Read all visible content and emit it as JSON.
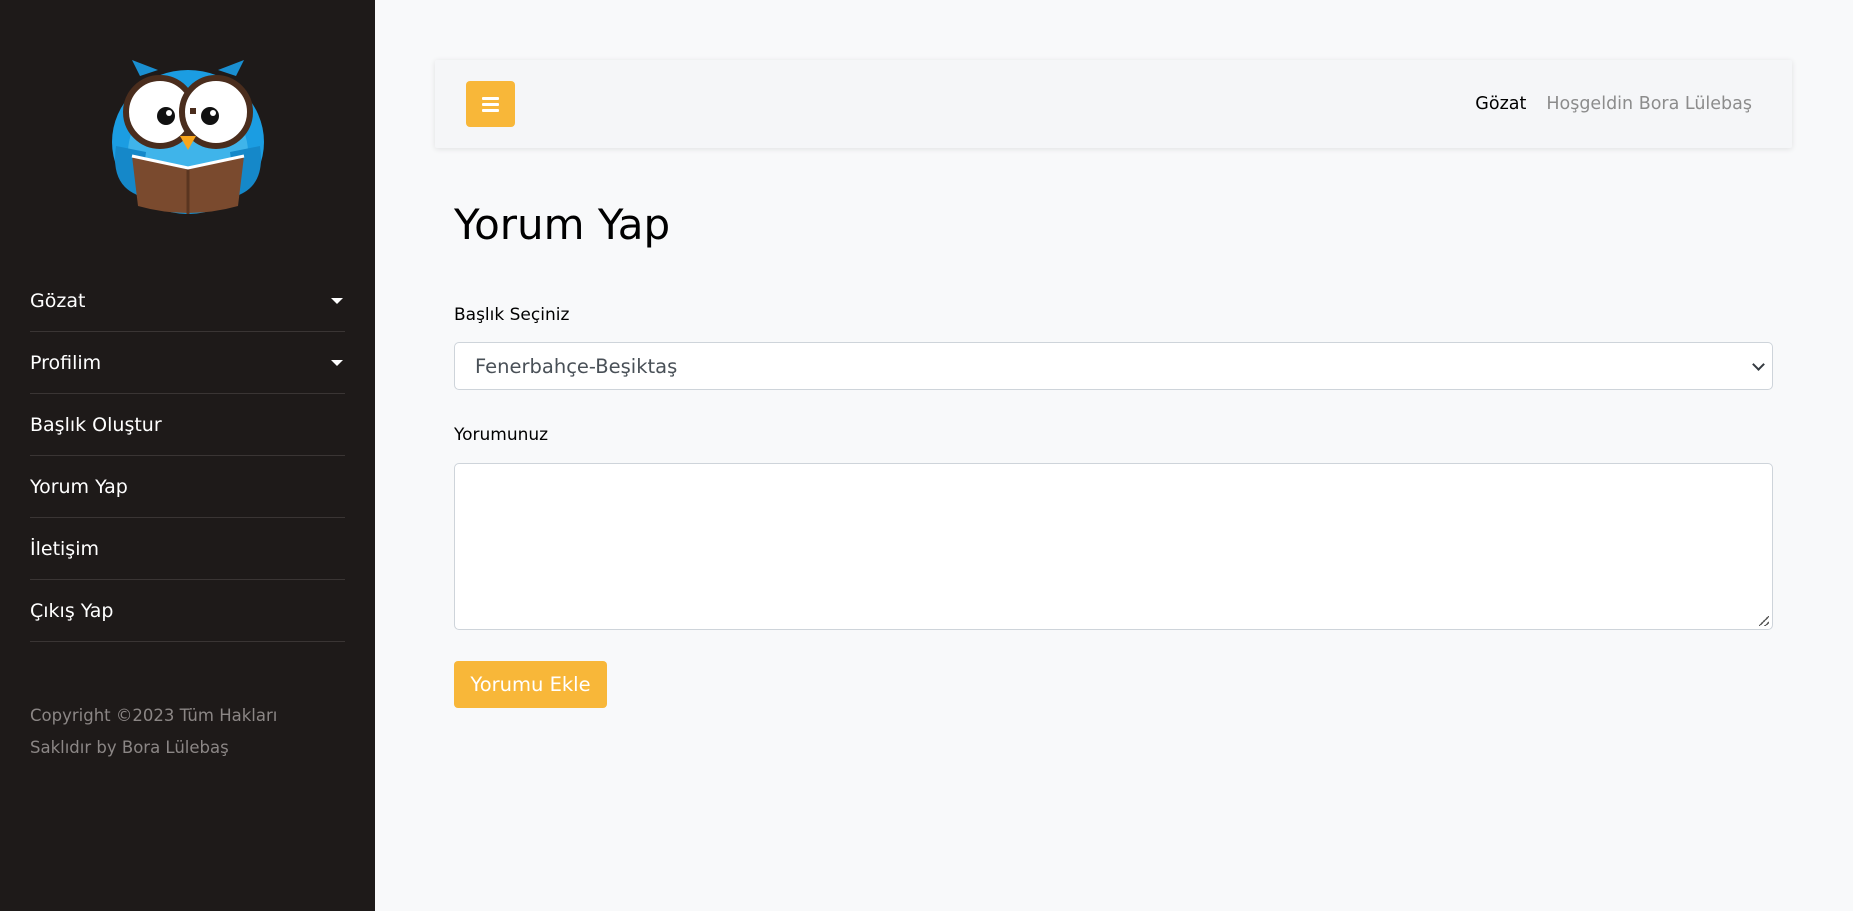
{
  "colors": {
    "sidebar_bg": "#1e1a19",
    "accent": "#f8b739",
    "page_bg": "#f8f9fa"
  },
  "sidebar": {
    "logo_icon": "owl-reading-book-logo",
    "items": [
      {
        "label": "Gözat",
        "has_dropdown": true
      },
      {
        "label": "Profilim",
        "has_dropdown": true
      },
      {
        "label": "Başlık Oluştur",
        "has_dropdown": false
      },
      {
        "label": "Yorum Yap",
        "has_dropdown": false
      },
      {
        "label": "İletişim",
        "has_dropdown": false
      },
      {
        "label": "Çıkış Yap",
        "has_dropdown": false
      }
    ],
    "footer_line1": "Copyright ©2023 Tüm Hakları",
    "footer_line2": "Saklıdır by Bora Lülebaş"
  },
  "topbar": {
    "menu_icon": "hamburger-icon",
    "nav_browse": "Gözat",
    "welcome": "Hoşgeldin Bora Lülebaş"
  },
  "form": {
    "title": "Yorum Yap",
    "topic_label": "Başlık Seçiniz",
    "topic_selected": "Fenerbahçe-Beşiktaş",
    "comment_label": "Yorumunuz",
    "comment_value": "",
    "submit_label": "Yorumu Ekle"
  }
}
